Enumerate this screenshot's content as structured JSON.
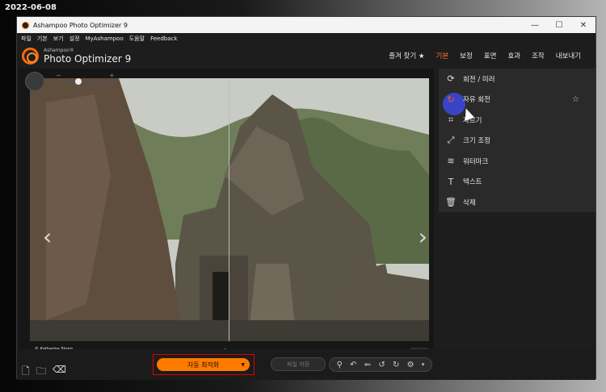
{
  "date_stamp": "2022-06-08",
  "window": {
    "title": "Ashampoo Photo Optimizer 9"
  },
  "menu": [
    "파일",
    "기본",
    "보기",
    "설정",
    "MyAshampoo",
    "도움말",
    "Feedback"
  ],
  "brand": {
    "small": "Ashampoo®",
    "big": "Photo Optimizer 9"
  },
  "main_tabs": [
    {
      "label": "즐겨 찾기 ★",
      "active": false
    },
    {
      "label": "기본",
      "active": true
    },
    {
      "label": "보정",
      "active": false
    },
    {
      "label": "표면",
      "active": false
    },
    {
      "label": "효과",
      "active": false
    },
    {
      "label": "조작",
      "active": false
    },
    {
      "label": "내보내기",
      "active": false
    }
  ],
  "tools": [
    {
      "label": "회전 / 미러",
      "icon": "rotate-icon"
    },
    {
      "label": "자유 회전",
      "icon": "free-rotate-icon",
      "starred": false
    },
    {
      "label": "자르기",
      "icon": "crop-icon"
    },
    {
      "label": "크기 조정",
      "icon": "resize-icon"
    },
    {
      "label": "워터마크",
      "icon": "watermark-icon"
    },
    {
      "label": "텍스트",
      "icon": "text-icon"
    },
    {
      "label": "삭제",
      "icon": "trash-icon"
    }
  ],
  "photo": {
    "credit": "© Katharina Stong"
  },
  "bottom": {
    "auto_optimize": "자동 최적화",
    "save": "파일 저장"
  },
  "colors": {
    "accent": "#ff7a00",
    "highlight": "#e00000",
    "cursor_ring": "#3b49e0"
  }
}
